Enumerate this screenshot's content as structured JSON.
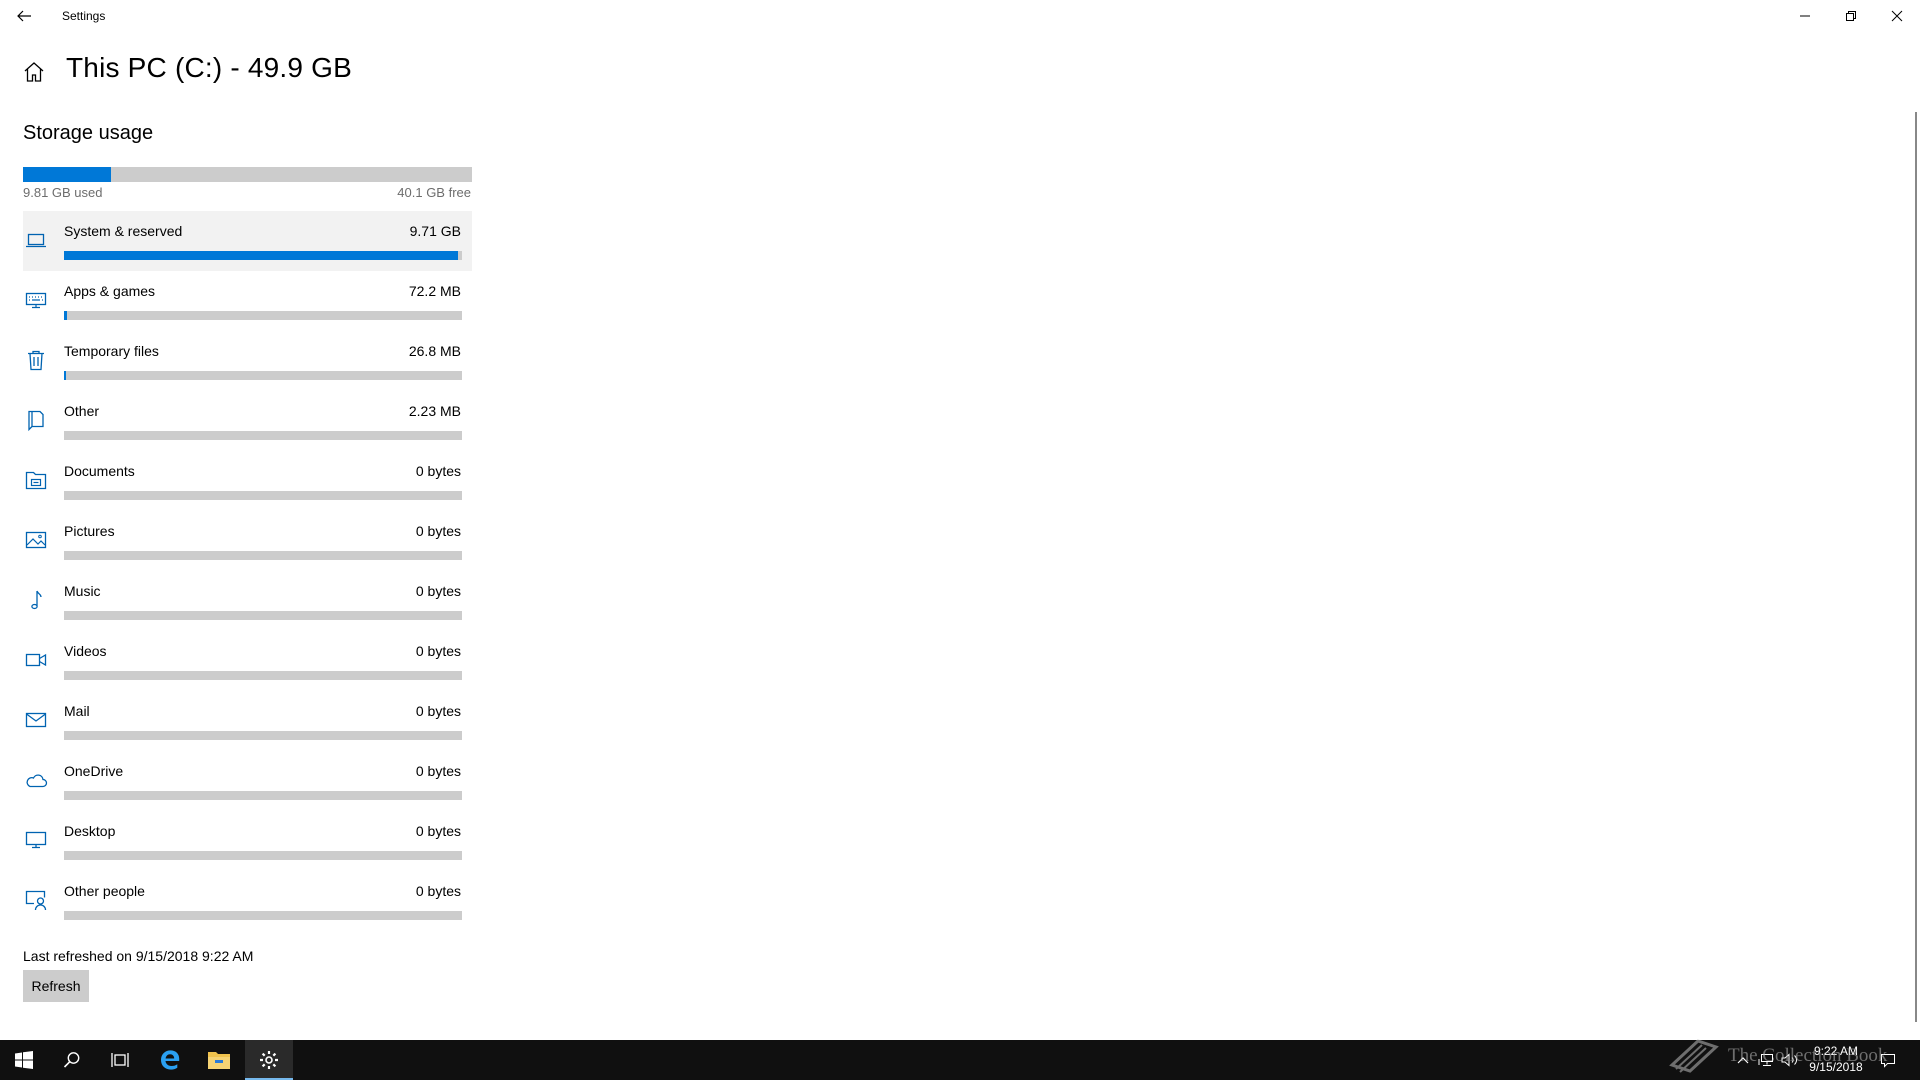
{
  "window": {
    "title": "Settings",
    "back_icon": "back-arrow-icon",
    "controls": [
      "minimize-icon",
      "restore-icon",
      "close-icon"
    ]
  },
  "header": {
    "home_icon": "home-icon",
    "title": "This PC (C:) - 49.9 GB"
  },
  "storage": {
    "section_title": "Storage usage",
    "used_fraction": 0.197,
    "used_label": "9.81 GB used",
    "free_label": "40.1 GB free",
    "accent_color": "#0078d7",
    "track_color": "#cccccc"
  },
  "categories": [
    {
      "name": "System & reserved",
      "size": "9.71 GB",
      "fraction": 0.99,
      "icon": "laptop-icon",
      "selected": true
    },
    {
      "name": "Apps & games",
      "size": "72.2 MB",
      "fraction": 0.007,
      "icon": "keyboard-icon",
      "selected": false
    },
    {
      "name": "Temporary files",
      "size": "26.8 MB",
      "fraction": 0.003,
      "icon": "trash-icon",
      "selected": false
    },
    {
      "name": "Other",
      "size": "2.23 MB",
      "fraction": 0.0,
      "icon": "other-icon",
      "selected": false
    },
    {
      "name": "Documents",
      "size": "0 bytes",
      "fraction": 0.0,
      "icon": "documents-icon",
      "selected": false
    },
    {
      "name": "Pictures",
      "size": "0 bytes",
      "fraction": 0.0,
      "icon": "pictures-icon",
      "selected": false
    },
    {
      "name": "Music",
      "size": "0 bytes",
      "fraction": 0.0,
      "icon": "music-icon",
      "selected": false
    },
    {
      "name": "Videos",
      "size": "0 bytes",
      "fraction": 0.0,
      "icon": "video-icon",
      "selected": false
    },
    {
      "name": "Mail",
      "size": "0 bytes",
      "fraction": 0.0,
      "icon": "mail-icon",
      "selected": false
    },
    {
      "name": "OneDrive",
      "size": "0 bytes",
      "fraction": 0.0,
      "icon": "cloud-icon",
      "selected": false
    },
    {
      "name": "Desktop",
      "size": "0 bytes",
      "fraction": 0.0,
      "icon": "desktop-icon",
      "selected": false
    },
    {
      "name": "Other people",
      "size": "0 bytes",
      "fraction": 0.0,
      "icon": "other-people-icon",
      "selected": false
    }
  ],
  "footer": {
    "last_refreshed": "Last refreshed on 9/15/2018 9:22 AM",
    "refresh_label": "Refresh"
  },
  "taskbar": {
    "items": [
      "start-icon",
      "search-icon",
      "task-view-icon",
      "edge-icon",
      "file-explorer-icon",
      "settings-icon"
    ],
    "active": "settings-icon",
    "tray_icons": [
      "chevron-up-icon",
      "network-icon",
      "volume-icon",
      "notifications-icon"
    ],
    "time": "9:22 AM",
    "date": "9/15/2018",
    "watermark": "The Collection Book"
  }
}
